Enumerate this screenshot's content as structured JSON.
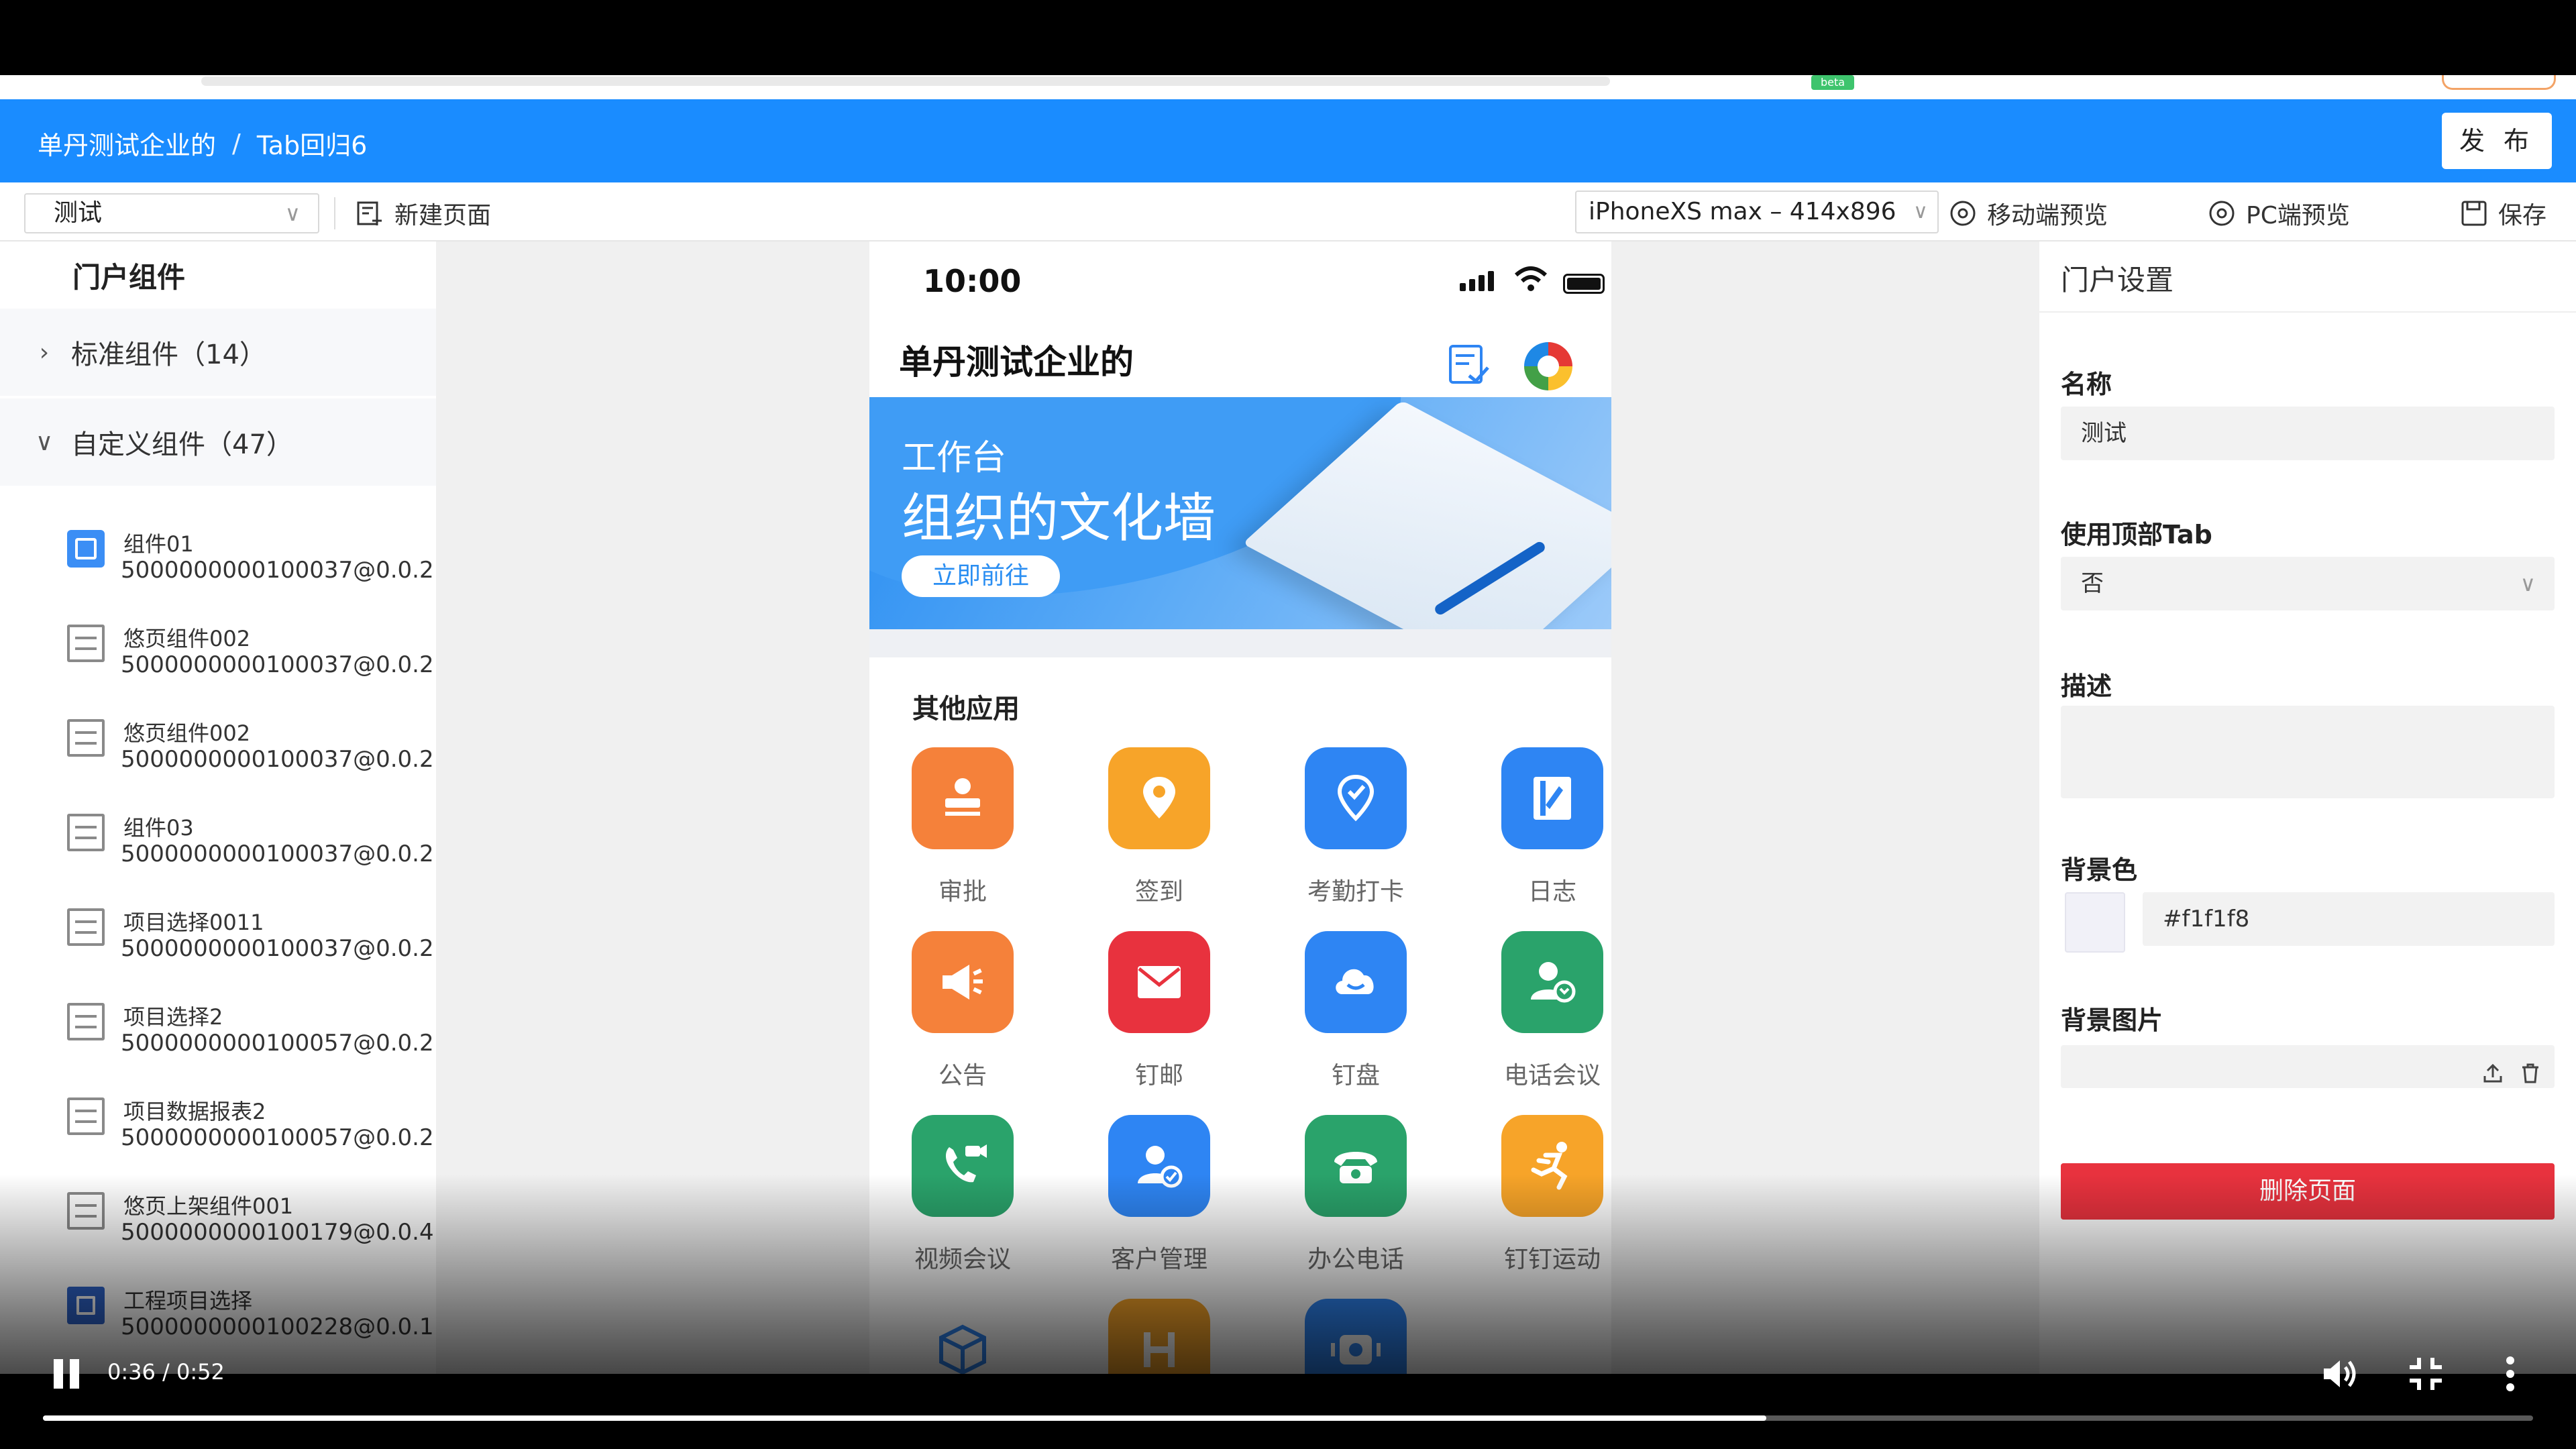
{
  "browser": {
    "beta_badge": "beta"
  },
  "header": {
    "breadcrumb": [
      "单丹测试企业的",
      "/",
      "Tab回归6"
    ],
    "publish_label": "发 布"
  },
  "toolbar": {
    "page_select_value": "测试",
    "new_page_label": "新建页面",
    "device_select_value": "iPhoneXS max – 414x896",
    "mobile_preview_label": "移动端预览",
    "pc_preview_label": "PC端预览",
    "save_label": "保存"
  },
  "left_panel": {
    "title": "门户组件",
    "groups": [
      {
        "label": "标准组件（14）",
        "expanded": false
      },
      {
        "label": "自定义组件（47）",
        "expanded": true
      }
    ],
    "components": [
      {
        "name": "组件01",
        "id": "5000000000100037@0.0.2",
        "icon": "image-icon"
      },
      {
        "name": "悠页组件002",
        "id": "5000000000100037@0.0.2",
        "icon": "layout-icon"
      },
      {
        "name": "悠页组件002",
        "id": "5000000000100037@0.0.2",
        "icon": "layout-icon"
      },
      {
        "name": "组件03",
        "id": "5000000000100037@0.0.2",
        "icon": "layout-icon"
      },
      {
        "name": "项目选择0011",
        "id": "5000000000100037@0.0.2",
        "icon": "layout-icon"
      },
      {
        "name": "项目选择2",
        "id": "5000000000100057@0.0.2",
        "icon": "layout-icon"
      },
      {
        "name": "项目数据报表2",
        "id": "5000000000100057@0.0.2",
        "icon": "layout-icon"
      },
      {
        "name": "悠页上架组件001",
        "id": "5000000000100179@0.0.4",
        "icon": "layout-icon"
      },
      {
        "name": "工程项目选择",
        "id": "5000000000100228@0.0.1",
        "icon": "org-chart-icon"
      }
    ]
  },
  "phone": {
    "time": "10:00",
    "title": "单丹测试企业的",
    "banner": {
      "subtitle": "工作台",
      "title": "组织的文化墙",
      "button": "立即前往"
    },
    "apps_title": "其他应用",
    "apps": [
      {
        "label": "审批",
        "color": "#f5813a",
        "icon": "approval-icon"
      },
      {
        "label": "签到",
        "color": "#f7a429",
        "icon": "checkin-icon"
      },
      {
        "label": "考勤打卡",
        "color": "#2e85f3",
        "icon": "attendance-icon"
      },
      {
        "label": "日志",
        "color": "#2e85f3",
        "icon": "log-icon"
      },
      {
        "label": "公告",
        "color": "#f5813a",
        "icon": "announcement-icon"
      },
      {
        "label": "钉邮",
        "color": "#e8323e",
        "icon": "mail-icon"
      },
      {
        "label": "钉盘",
        "color": "#2e85f3",
        "icon": "cloud-drive-icon"
      },
      {
        "label": "电话会议",
        "color": "#2aa36b",
        "icon": "phone-meeting-icon"
      },
      {
        "label": "视频会议",
        "color": "#2aa36b",
        "icon": "video-meeting-icon"
      },
      {
        "label": "客户管理",
        "color": "#2e85f3",
        "icon": "customer-icon"
      },
      {
        "label": "办公电话",
        "color": "#2aa36b",
        "icon": "office-phone-icon"
      },
      {
        "label": "钉钉运动",
        "color": "#f7a429",
        "icon": "sport-icon"
      },
      {
        "label": "",
        "color": "#2e85f3",
        "icon": "box-icon"
      },
      {
        "label": "",
        "color": "#f7a429",
        "icon": "h-app-icon"
      },
      {
        "label": "",
        "color": "#2e85f3",
        "icon": "device-icon"
      }
    ]
  },
  "right_panel": {
    "title": "门户设置",
    "name_label": "名称",
    "name_value": "测试",
    "top_tab_label": "使用顶部Tab",
    "top_tab_value": "否",
    "desc_label": "描述",
    "bg_color_label": "背景色",
    "bg_color_value": "#f1f1f8",
    "bg_image_label": "背景图片",
    "delete_label": "删除页面"
  },
  "video": {
    "time": "0:36 / 0:52",
    "progress": 0.692
  }
}
